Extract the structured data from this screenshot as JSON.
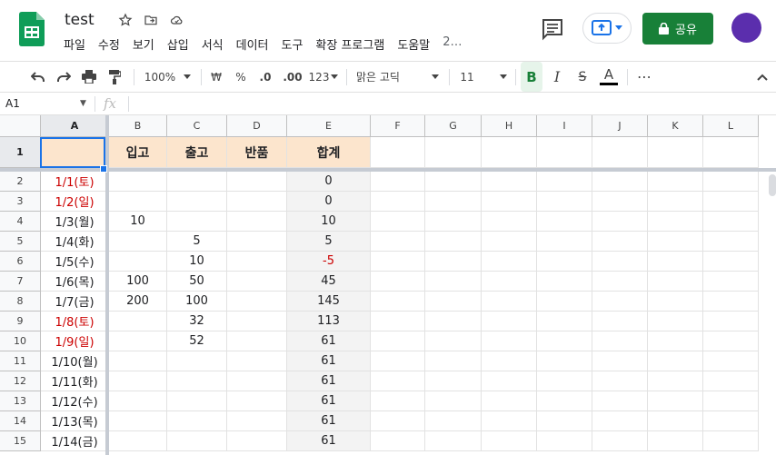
{
  "doc": {
    "title": "test"
  },
  "menu": [
    "파일",
    "수정",
    "보기",
    "삽입",
    "서식",
    "데이터",
    "도구",
    "확장 프로그램",
    "도움말",
    "2…"
  ],
  "share": {
    "label": "공유"
  },
  "toolbar": {
    "zoom": "100%",
    "currency": "₩",
    "percent": "%",
    "dec_less": ".0",
    "dec_more": ".00",
    "more_formats": "123",
    "font": "맑은 고딕",
    "size": "11",
    "bold": "B",
    "italic": "I",
    "strike": "S",
    "textcolor": "A",
    "more": "⋯"
  },
  "formula": {
    "cell_ref": "A1",
    "fx": "fx",
    "content": ""
  },
  "columns": [
    "A",
    "B",
    "C",
    "D",
    "E",
    "F",
    "G",
    "H",
    "I",
    "J",
    "K",
    "L"
  ],
  "header_row": {
    "A": "",
    "B": "입고",
    "C": "출고",
    "D": "반품",
    "E": "합계"
  },
  "rows": [
    {
      "num": "2",
      "date": "1/1(토)",
      "in": "",
      "out": "",
      "total": "0",
      "date_red": true,
      "total_red": false
    },
    {
      "num": "3",
      "date": "1/2(일)",
      "in": "",
      "out": "",
      "total": "0",
      "date_red": true,
      "total_red": false
    },
    {
      "num": "4",
      "date": "1/3(월)",
      "in": "10",
      "out": "",
      "total": "10",
      "date_red": false,
      "total_red": false
    },
    {
      "num": "5",
      "date": "1/4(화)",
      "in": "",
      "out": "5",
      "total": "5",
      "date_red": false,
      "total_red": false
    },
    {
      "num": "6",
      "date": "1/5(수)",
      "in": "",
      "out": "10",
      "total": "-5",
      "date_red": false,
      "total_red": true
    },
    {
      "num": "7",
      "date": "1/6(목)",
      "in": "100",
      "out": "50",
      "total": "45",
      "date_red": false,
      "total_red": false
    },
    {
      "num": "8",
      "date": "1/7(금)",
      "in": "200",
      "out": "100",
      "total": "145",
      "date_red": false,
      "total_red": false
    },
    {
      "num": "9",
      "date": "1/8(토)",
      "in": "",
      "out": "32",
      "total": "113",
      "date_red": true,
      "total_red": false
    },
    {
      "num": "10",
      "date": "1/9(일)",
      "in": "",
      "out": "52",
      "total": "61",
      "date_red": true,
      "total_red": false
    },
    {
      "num": "11",
      "date": "1/10(월)",
      "in": "",
      "out": "",
      "total": "61",
      "date_red": false,
      "total_red": false
    },
    {
      "num": "12",
      "date": "1/11(화)",
      "in": "",
      "out": "",
      "total": "61",
      "date_red": false,
      "total_red": false
    },
    {
      "num": "13",
      "date": "1/12(수)",
      "in": "",
      "out": "",
      "total": "61",
      "date_red": false,
      "total_red": false
    },
    {
      "num": "14",
      "date": "1/13(목)",
      "in": "",
      "out": "",
      "total": "61",
      "date_red": false,
      "total_red": false
    },
    {
      "num": "15",
      "date": "1/14(금)",
      "in": "",
      "out": "",
      "total": "61",
      "date_red": false,
      "total_red": false
    }
  ],
  "colors": {
    "accent": "#188038",
    "selection": "#1a73e8",
    "header_fill": "#fce5cd",
    "weekend": "#cc0000",
    "avatar": "#5b2ead"
  }
}
